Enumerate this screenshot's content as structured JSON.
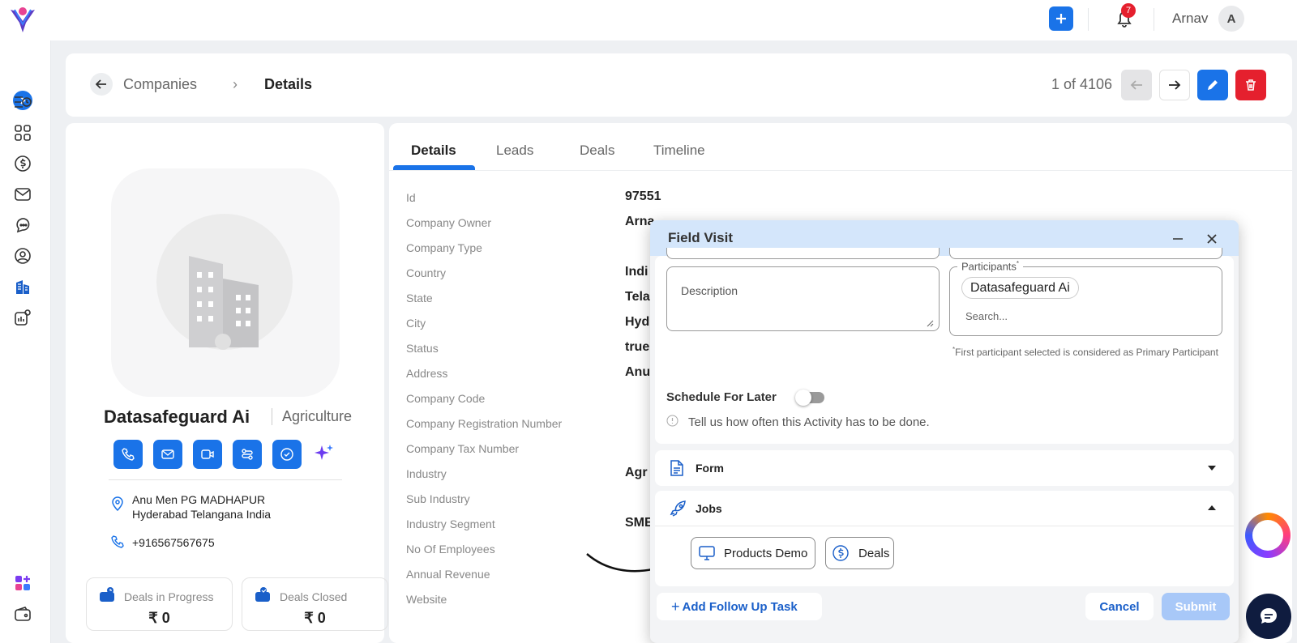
{
  "topbar": {
    "user_name": "Arnav",
    "avatar_initial": "A",
    "notification_count": "7"
  },
  "breadcrumb": {
    "parent": "Companies",
    "current": "Details"
  },
  "pager": {
    "text": "1 of 4106"
  },
  "company": {
    "name": "Datasafeguard Ai",
    "industry": "Agriculture",
    "address_line1": "Anu Men PG MADHAPUR",
    "address_line2": "Hyderabad Telangana India",
    "phone": "+916567567675"
  },
  "stats": [
    {
      "label": "Deals in Progress",
      "value": "₹ 0"
    },
    {
      "label": "Deals Closed",
      "value": "₹ 0"
    }
  ],
  "tabs": [
    "Details",
    "Leads",
    "Deals",
    "Timeline"
  ],
  "fields": [
    {
      "label": "Id",
      "value": "97551"
    },
    {
      "label": "Company Owner",
      "value": "Arna"
    },
    {
      "label": "Company Type",
      "value": ""
    },
    {
      "label": "Country",
      "value": "Indi"
    },
    {
      "label": "State",
      "value": "Tela"
    },
    {
      "label": "City",
      "value": "Hyd"
    },
    {
      "label": "Status",
      "value": "true"
    },
    {
      "label": "Address",
      "value": "Anu"
    },
    {
      "label": "Company Code",
      "value": ""
    },
    {
      "label": "Company Registration Number",
      "value": ""
    },
    {
      "label": "Company Tax Number",
      "value": ""
    },
    {
      "label": "Industry",
      "value": "Agr"
    },
    {
      "label": "Sub Industry",
      "value": ""
    },
    {
      "label": "Industry Segment",
      "value": "SME"
    },
    {
      "label": "No Of Employees",
      "value": ""
    },
    {
      "label": "Annual Revenue",
      "value": ""
    },
    {
      "label": "Website",
      "value": ""
    }
  ],
  "modal": {
    "title": "Field Visit",
    "description_placeholder": "Description",
    "participants_label": "Participants",
    "participant_chip": "Datasafeguard Ai",
    "search_placeholder": "Search...",
    "participants_note": "First participant selected is considered as Primary Participant",
    "schedule_label": "Schedule For Later",
    "schedule_hint": "Tell us how often this Activity has to be done.",
    "form_label": "Form",
    "jobs_label": "Jobs",
    "jobs": [
      "Products Demo",
      "Deals"
    ],
    "add_follow_up": "Add Follow Up Task",
    "cancel": "Cancel",
    "submit": "Submit"
  },
  "colors": {
    "accent": "#1a73e8",
    "danger": "#e5202e",
    "modal_header": "#d4e6fb"
  }
}
